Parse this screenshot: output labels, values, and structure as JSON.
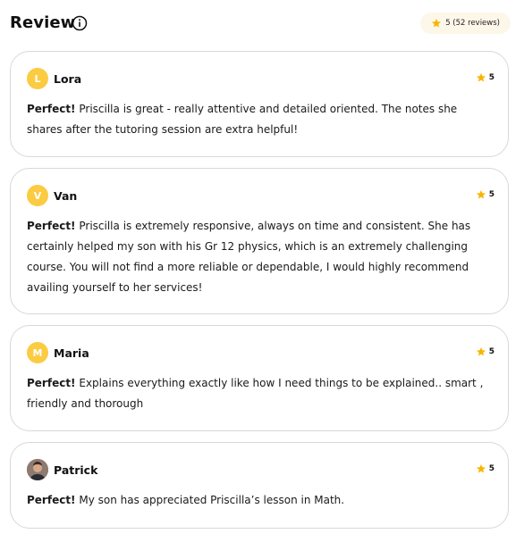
{
  "header": {
    "title": "Review",
    "rating_summary": "5 (52 reviews)"
  },
  "colors": {
    "star": "#f7b500",
    "avatar": "#fbcb42",
    "pill_bg": "#fdf7ea",
    "border": "#d8d8dc"
  },
  "reviews": [
    {
      "initial": "L",
      "name": "Lora",
      "rating": "5",
      "lead": "Perfect!",
      "text": "Priscilla is great - really attentive and detailed oriented. The notes she shares after the tutoring session are extra helpful!"
    },
    {
      "initial": "V",
      "name": "Van",
      "rating": "5",
      "lead": "Perfect!",
      "text": "Priscilla is extremely responsive, always on time and consistent. She has certainly helped my son with his Gr 12 physics, which is an extremely challenging course. You will not find a more reliable or dependable, I would highly recommend availing yourself to her services!"
    },
    {
      "initial": "M",
      "name": "Maria",
      "rating": "5",
      "lead": "Perfect!",
      "text": "Explains everything exactly like how I need things to be explained.. smart , friendly and thorough"
    },
    {
      "initial": "",
      "name": "Patrick",
      "rating": "5",
      "lead": "Perfect!",
      "text": "My son has appreciated Priscilla’s lesson in Math."
    }
  ]
}
